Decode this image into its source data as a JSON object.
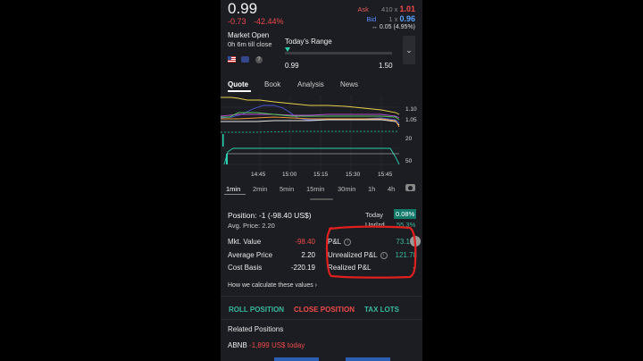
{
  "quote": {
    "price": "0.99",
    "change": "-0.73",
    "change_pct": "-42.44%",
    "ask_label": "Ask",
    "ask_size": "410 x",
    "ask_price": "1.01",
    "bid_label": "Bid",
    "bid_size": "1 x",
    "bid_price": "0.96",
    "spread": "↔ 0.05 (4.95%)"
  },
  "market": {
    "status": "Market Open",
    "till_close": "0h 6m till close"
  },
  "range": {
    "title": "Today's Range",
    "low": "0.99",
    "high": "1.50",
    "position_fraction": 0.0
  },
  "tabs": [
    "Quote",
    "Book",
    "Analysis",
    "News"
  ],
  "active_tab": "Quote",
  "chart_labels": {
    "price_ticks": [
      "1.10",
      "1.05"
    ],
    "volume_ticks": [
      "20",
      "50"
    ],
    "time_ticks": [
      "14:45",
      "15:00",
      "15:15",
      "15:30",
      "15:45"
    ]
  },
  "timeframes": [
    "1min",
    "2min",
    "5min",
    "15min",
    "30min",
    "1h",
    "4h"
  ],
  "active_timeframe": "1min",
  "position": {
    "title": "Position: -1 (-98.40 US$)",
    "avg_price": "Avg. Price: 2.20",
    "today_label": "Today",
    "today_value": "0.08%",
    "unrlzd_label": "Unrlzd",
    "unrlzd_value": "55.3%"
  },
  "details": {
    "mkt_value_label": "Mkt. Value",
    "mkt_value": "-98.40",
    "avg_price_label": "Average Price",
    "avg_price": "2.20",
    "cost_basis_label": "Cost Basis",
    "cost_basis": "-220.19",
    "pnl_label": "P&L",
    "pnl": "73.1",
    "unrealized_label": "Unrealized P&L",
    "unrealized": "121.78",
    "realized_label": "Realized P&L",
    "realized": "-"
  },
  "how_calc": "How we calculate these values",
  "actions": {
    "roll": "ROLL POSITION",
    "close": "CLOSE POSITION",
    "tax": "TAX LOTS"
  },
  "related": {
    "title": "Related Positions",
    "ticker": "ABNB",
    "value": "-1,899 US$ today"
  },
  "colors": {
    "accent_green": "#3ab89f",
    "down_red": "#f04a4a",
    "bid_blue": "#5aa0ff",
    "annotation_red": "#e0201e"
  }
}
